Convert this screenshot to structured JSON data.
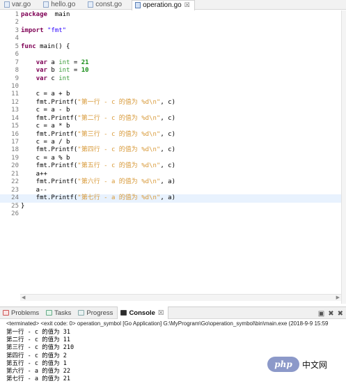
{
  "tabs": [
    {
      "label": "var.go",
      "active": false
    },
    {
      "label": "hello.go",
      "active": false
    },
    {
      "label": "const.go",
      "active": false
    },
    {
      "label": "operation.go",
      "active": true,
      "close": "☒"
    }
  ],
  "code_lines": [
    {
      "n": "1",
      "parts": [
        [
          "kw",
          "package"
        ],
        [
          "",
          "  main"
        ]
      ]
    },
    {
      "n": "2",
      "parts": []
    },
    {
      "n": "3",
      "parts": [
        [
          "kw",
          "import"
        ],
        [
          "",
          " "
        ],
        [
          "str",
          "\"fmt\""
        ]
      ]
    },
    {
      "n": "4",
      "parts": []
    },
    {
      "n": "5",
      "parts": [
        [
          "kw",
          "func"
        ],
        [
          "",
          " main() {"
        ]
      ]
    },
    {
      "n": "6",
      "parts": []
    },
    {
      "n": "7",
      "parts": [
        [
          "",
          "    "
        ],
        [
          "kw",
          "var"
        ],
        [
          "",
          " a "
        ],
        [
          "type",
          "int"
        ],
        [
          "",
          " = "
        ],
        [
          "num",
          "21"
        ]
      ]
    },
    {
      "n": "8",
      "parts": [
        [
          "",
          "    "
        ],
        [
          "kw",
          "var"
        ],
        [
          "",
          " b "
        ],
        [
          "type",
          "int"
        ],
        [
          "",
          " = "
        ],
        [
          "num",
          "10"
        ]
      ]
    },
    {
      "n": "9",
      "parts": [
        [
          "",
          "    "
        ],
        [
          "kw",
          "var"
        ],
        [
          "",
          " c "
        ],
        [
          "type",
          "int"
        ]
      ]
    },
    {
      "n": "10",
      "parts": []
    },
    {
      "n": "11",
      "parts": [
        [
          "",
          "    c = a + b"
        ]
      ]
    },
    {
      "n": "12",
      "parts": [
        [
          "",
          "    fmt.Printf("
        ],
        [
          "str-cn",
          "\"第一行 - c 的值为 %d\\n\""
        ],
        [
          "",
          ", c)"
        ]
      ]
    },
    {
      "n": "13",
      "parts": [
        [
          "",
          "    c = a - b"
        ]
      ]
    },
    {
      "n": "14",
      "parts": [
        [
          "",
          "    fmt.Printf("
        ],
        [
          "str-cn",
          "\"第二行 - c 的值为 %d\\n\""
        ],
        [
          "",
          ", c)"
        ]
      ]
    },
    {
      "n": "15",
      "parts": [
        [
          "",
          "    c = a * b"
        ]
      ]
    },
    {
      "n": "16",
      "parts": [
        [
          "",
          "    fmt.Printf("
        ],
        [
          "str-cn",
          "\"第三行 - c 的值为 %d\\n\""
        ],
        [
          "",
          ", c)"
        ]
      ]
    },
    {
      "n": "17",
      "parts": [
        [
          "",
          "    c = a / b"
        ]
      ]
    },
    {
      "n": "18",
      "parts": [
        [
          "",
          "    fmt.Printf("
        ],
        [
          "str-cn",
          "\"第四行 - c 的值为 %d\\n\""
        ],
        [
          "",
          ", c)"
        ]
      ]
    },
    {
      "n": "19",
      "parts": [
        [
          "",
          "    c = a % b"
        ]
      ]
    },
    {
      "n": "20",
      "parts": [
        [
          "",
          "    fmt.Printf("
        ],
        [
          "str-cn",
          "\"第五行 - c 的值为 %d\\n\""
        ],
        [
          "",
          ", c)"
        ]
      ]
    },
    {
      "n": "21",
      "parts": [
        [
          "",
          "    a++"
        ]
      ]
    },
    {
      "n": "22",
      "parts": [
        [
          "",
          "    fmt.Printf("
        ],
        [
          "str-cn",
          "\"第六行 - a 的值为 %d\\n\""
        ],
        [
          "",
          ", a)"
        ]
      ]
    },
    {
      "n": "23",
      "parts": [
        [
          "",
          "    a--"
        ]
      ]
    },
    {
      "n": "24",
      "parts": [
        [
          "",
          "    fmt.Printf("
        ],
        [
          "str-cn",
          "\"第七行 - a 的值为 %d\\n\""
        ],
        [
          "",
          ", a)"
        ]
      ],
      "current": true
    },
    {
      "n": "25",
      "parts": [
        [
          "",
          "}"
        ]
      ]
    },
    {
      "n": "26",
      "parts": []
    }
  ],
  "panel": {
    "tabs": [
      {
        "label": "Problems",
        "icon": "problems-icon"
      },
      {
        "label": "Tasks",
        "icon": "tasks-icon"
      },
      {
        "label": "Progress",
        "icon": "progress-icon"
      },
      {
        "label": "Console",
        "icon": "console-icon",
        "active": true,
        "close": "☒"
      }
    ],
    "tool_a": "▣",
    "tool_b": "✖",
    "tool_c": "✖"
  },
  "console": {
    "header": "<terminated> <exit code: 0> operation_symbol [Go Application] G:\\MyProgram\\Go\\operation_symbol\\bin\\main.exe (2018-9-9 15:59",
    "lines": [
      "第一行 - c 的值为 31",
      "第二行 - c 的值为 11",
      "第三行 - c 的值为 210",
      "第四行 - c 的值为 2",
      "第五行 - c 的值为 1",
      "第六行 - a 的值为 22",
      "第七行 - a 的值为 21"
    ]
  },
  "watermark": {
    "badge": "php",
    "text": "中文网"
  }
}
